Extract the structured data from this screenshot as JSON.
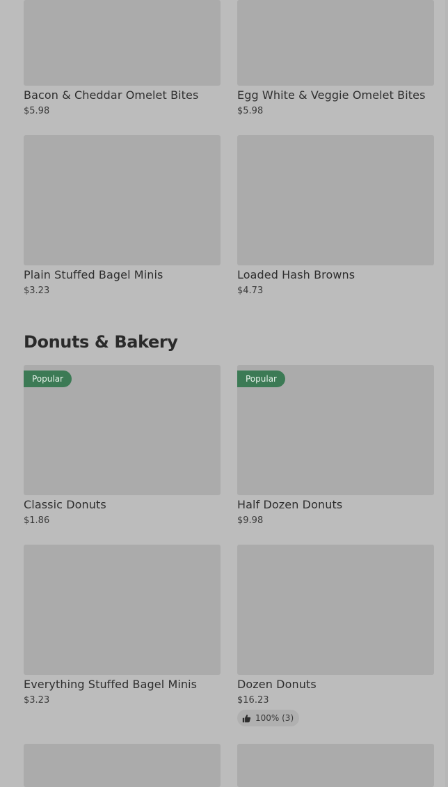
{
  "rows_top": [
    {
      "name": "Bacon & Cheddar Omelet Bites",
      "price": "$5.98"
    },
    {
      "name": "Egg White & Veggie Omelet Bites",
      "price": "$5.98"
    },
    {
      "name": "Plain Stuffed Bagel Minis",
      "price": "$3.23"
    },
    {
      "name": "Loaded Hash Browns",
      "price": "$4.73"
    }
  ],
  "section": {
    "title": "Donuts & Bakery",
    "items": [
      {
        "name": "Classic Donuts",
        "price": "$1.86",
        "badge": "Popular"
      },
      {
        "name": "Half Dozen Donuts",
        "price": "$9.98",
        "badge": "Popular"
      },
      {
        "name": "Everything Stuffed Bagel Minis",
        "price": "$3.23"
      },
      {
        "name": "Dozen Donuts",
        "price": "$16.23",
        "rating": "100% (3)",
        "rating_icon": "thumbs-up-icon"
      }
    ]
  },
  "colors": {
    "background": "#bcbcbc",
    "image_placeholder": "#ababab",
    "badge": "#3c7a55",
    "badge_text": "#e9f3ec"
  }
}
